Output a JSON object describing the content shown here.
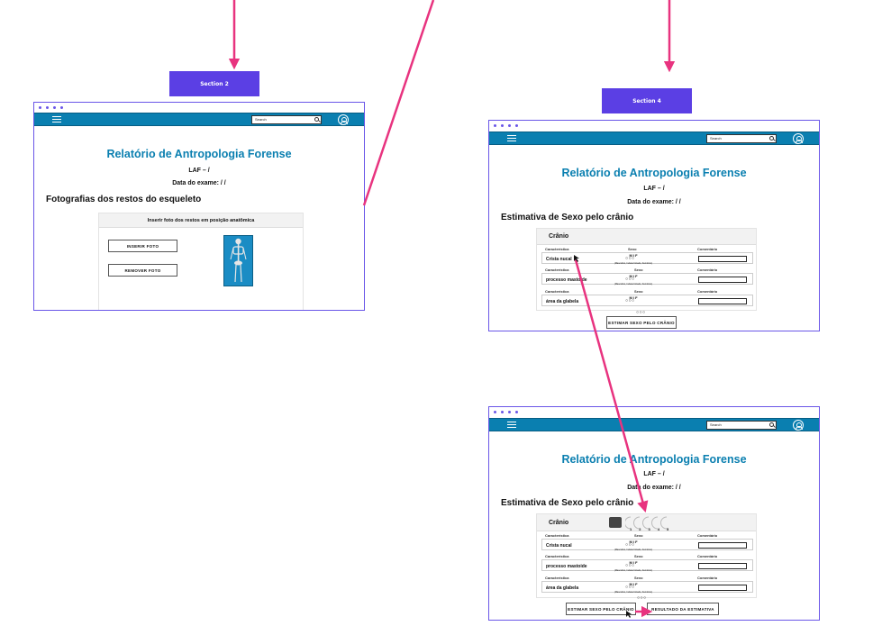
{
  "sections": {
    "section2_label": "Section 2",
    "section4_label": "Section 4"
  },
  "screen_common": {
    "search_placeholder": "Search",
    "report_title": "Relatório de Antropologia Forense",
    "laf_line": "LAF –  /",
    "exam_date": "Data do exame: / /"
  },
  "screen1": {
    "heading": "Fotografias dos restos do esqueleto",
    "card_header": "Inserir foto dos restos em posição anatômica",
    "insert_button": "INSERIR FOTO",
    "remove_button": "REMOVER FOTO"
  },
  "screen2": {
    "heading": "Estimativa de Sexo pelo crânio",
    "card_title": "Crânio",
    "col_characteristic": "Característica",
    "col_sex": "Sexo",
    "col_comment": "Comentário",
    "sex_options": "M  I  F",
    "radios": "○○○",
    "hint": "(Masculino, Indeterminado, Feminino)",
    "traits": [
      "Crista nucal",
      "processo mastoide",
      "área da glabela"
    ],
    "estimate_button": "ESTIMAR SEXO PELO CRÂNIO"
  },
  "screen3": {
    "heading": "Estimativa de Sexo pelo crânio",
    "card_title": "Crânio",
    "scale_numbers": [
      "1",
      "2",
      "3",
      "4",
      "5"
    ],
    "col_characteristic": "Característica",
    "col_sex": "Sexo",
    "col_comment": "Comentário",
    "sex_options": "M  I  F",
    "radios": "○○○",
    "hint": "(Masculino, Indeterminado, Feminino)",
    "traits": [
      "Crista nucal",
      "processo mastoide",
      "área da glabela"
    ],
    "estimate_button": "ESTIMAR SEXO PELO CRÂNIO",
    "result_button": "RESULTADO DA ESTIMATIVA"
  },
  "colors": {
    "accent": "#5b3fe4",
    "navbar": "#0a7fb0",
    "arrow": "#e8337f"
  }
}
